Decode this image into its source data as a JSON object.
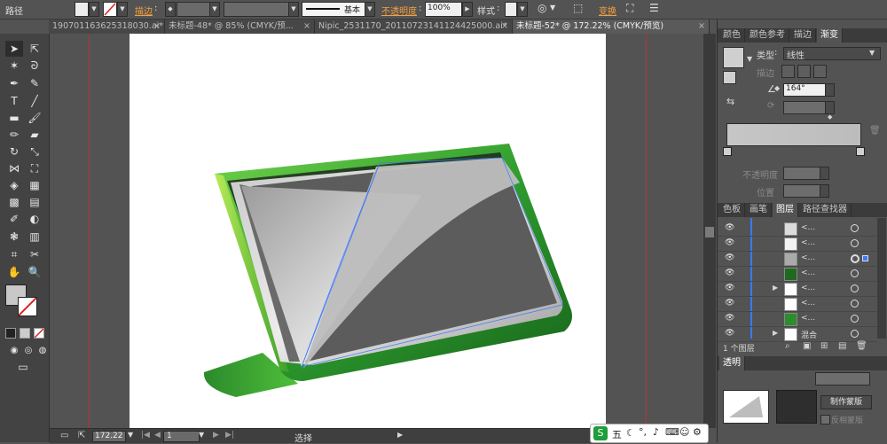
{
  "control_bar": {
    "path_label": "路径",
    "stroke_label": "描边",
    "stroke_weight_style": "基本",
    "opacity_label": "不透明度",
    "opacity_value": "100%",
    "style_label": "样式",
    "transform_label": "变换"
  },
  "tabs": [
    {
      "label": "190701163625318030.ai*",
      "active": false
    },
    {
      "label": "未标题-48* @ 85% (CMYK/预...",
      "active": false
    },
    {
      "label": "Nipic_2531170_20110723141124425000.ai*",
      "active": false
    },
    {
      "label": "未标题-52* @ 172.22% (CMYK/预览)",
      "active": true
    }
  ],
  "status_bar": {
    "zoom": "172.22",
    "page": "1",
    "tool": "选择"
  },
  "gradient_panel": {
    "tabs": [
      "颜色",
      "颜色参考",
      "描边",
      "渐变"
    ],
    "active_tab": "渐变",
    "type_label": "类型",
    "type_value": "线性",
    "stroke_label": "描边",
    "angle_value": "164°",
    "opacity_label": "不透明度",
    "location_label": "位置"
  },
  "layers_panel": {
    "tabs": [
      "色板",
      "画笔",
      "图层",
      "路径查找器"
    ],
    "active_tab": "图层",
    "rows": [
      {
        "name": "<...",
        "thumb": "#dcdcdc",
        "expand": false,
        "selected": false
      },
      {
        "name": "<...",
        "thumb": "#f2f2f2",
        "expand": false,
        "selected": false
      },
      {
        "name": "<...",
        "thumb": "#aaaaaa",
        "expand": false,
        "selected": true
      },
      {
        "name": "<...",
        "thumb": "#1e6a1e",
        "expand": false,
        "selected": false
      },
      {
        "name": "<...",
        "thumb": "#ffffff",
        "expand": true,
        "selected": false
      },
      {
        "name": "<...",
        "thumb": "#ffffff",
        "expand": false,
        "selected": false
      },
      {
        "name": "<...",
        "thumb": "#2e8b2e",
        "expand": false,
        "selected": false
      },
      {
        "name": "混合",
        "thumb": "#ffffff",
        "expand": true,
        "selected": false
      }
    ],
    "footer": "1 个图层"
  },
  "transparency_panel": {
    "tab": "透明",
    "make_mask": "制作蒙版",
    "invert_mask": "反相蒙版"
  },
  "ime_bar": {
    "mode": "五"
  },
  "colors": {
    "accent_orange": "#f5a040",
    "guide_red": "#b23434",
    "stand_green": "#3aaa35",
    "selection_blue": "#3c78ff"
  }
}
